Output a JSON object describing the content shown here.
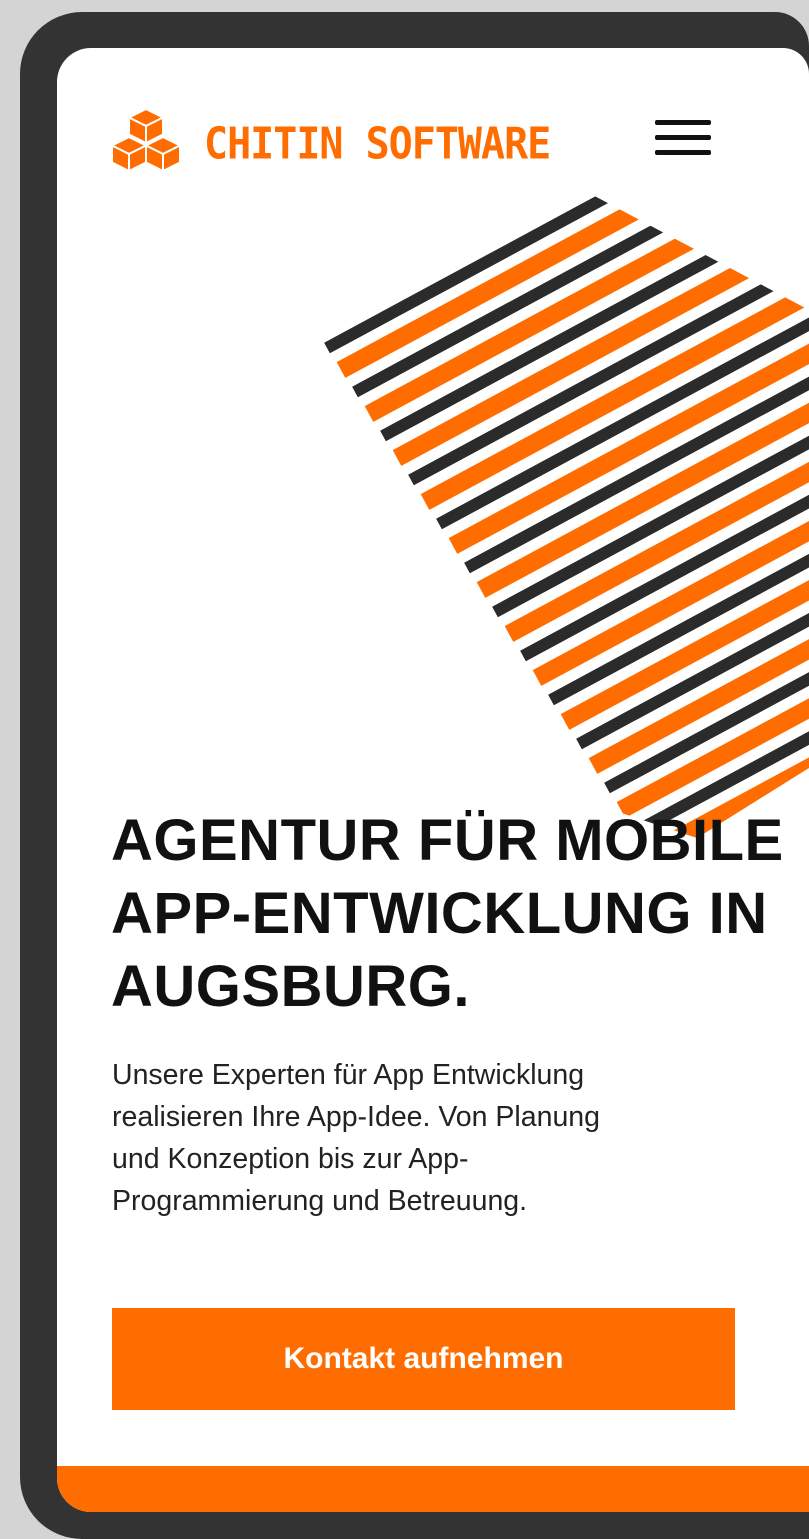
{
  "colors": {
    "accent": "#ff6d00",
    "dark": "#2b2b2b",
    "text": "#111111"
  },
  "header": {
    "logo_icon": "cube-cluster-logo",
    "brand_name": "CHITIN SOFTWARE",
    "menu_icon": "hamburger-menu-icon"
  },
  "hero": {
    "headline_lines": [
      "AGENTUR FÜR MOBILE",
      "APP-ENTWICKLUNG IN",
      "AUGSBURG."
    ],
    "description_lines": [
      "Unsere Experten für App Entwicklung",
      "realisieren Ihre App-Idee. Von Planung",
      "und Konzeption bis zur App-",
      "Programmierung und Betreuung."
    ],
    "cta_label": "Kontakt aufnehmen"
  }
}
